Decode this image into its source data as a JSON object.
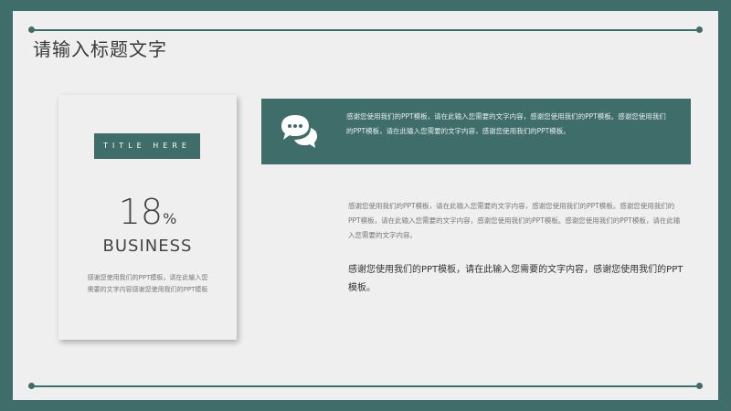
{
  "slide": {
    "title": "请输入标题文字"
  },
  "card": {
    "title_box": "TITLE HERE",
    "big_number": "18",
    "percent_sign": "%",
    "label": "BUSINESS",
    "description": "感谢您使用我们的PPT模板，请在此输入您需要的文字内容感谢您使用我们的PPT模板"
  },
  "banner": {
    "icon": "chat-bubbles-icon",
    "text": "感谢您使用我们的PPT模板，请在此输入您需要的文字内容，感谢您使用我们的PPT模板。感谢您使用我们的PPT模板，请在此输入您需要的文字内容，感谢您使用我们的PPT模板。"
  },
  "body": {
    "paragraph": "感谢您使用我们的PPT模板，请在此输入您需要的文字内容，感谢您使用我们的PPT模板。感谢您使用我们的PPT模板，请在此输入您需要的文字内容，感谢您使用我们的PPT模板。感谢您使用我们的PPT模板，请在此输入您需要的文字内容。",
    "highlight": "感谢您使用我们的PPT模板，请在此输入您需要的文字内容，感谢您使用我们的PPT模板。"
  },
  "colors": {
    "accent": "#3f6d6a",
    "background": "#efefef"
  }
}
